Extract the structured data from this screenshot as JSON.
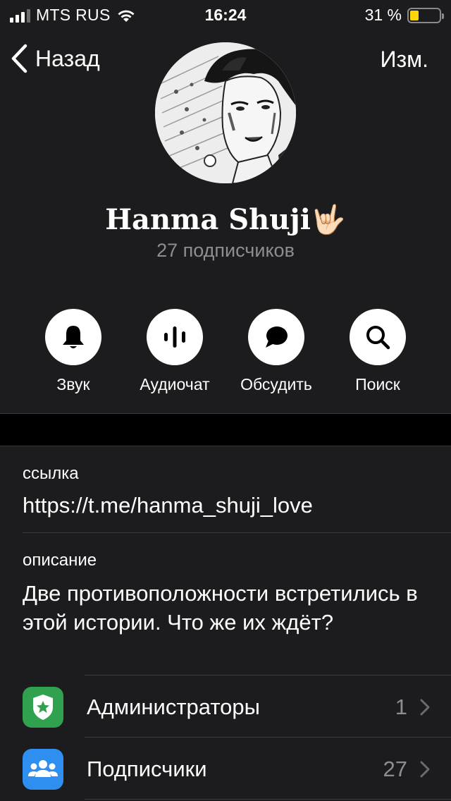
{
  "status_bar": {
    "carrier": "MTS RUS",
    "time": "16:24",
    "battery_percent": "31 %",
    "battery_level": 0.31
  },
  "nav": {
    "back_label": "Назад",
    "edit_label": "Изм."
  },
  "channel": {
    "name": "Hanma Shuji🤟🏻",
    "subscribers": "27 подписчиков"
  },
  "actions": [
    {
      "label": "Звук",
      "icon": "bell-icon"
    },
    {
      "label": "Аудиочат",
      "icon": "voice-chat-icon"
    },
    {
      "label": "Обсудить",
      "icon": "chat-bubble-icon"
    },
    {
      "label": "Поиск",
      "icon": "search-icon"
    }
  ],
  "info": {
    "link_label": "ссылка",
    "link_value": "https://t.me/hanma_shuji_love",
    "description_label": "описание",
    "description_value": "Две противоположности встретились в этой истории. Что же их ждёт?"
  },
  "rows": [
    {
      "label": "Администраторы",
      "count": "1",
      "icon": "admin-badge-icon",
      "color": "#30a14e"
    },
    {
      "label": "Подписчики",
      "count": "27",
      "icon": "people-icon",
      "color": "#2f8ff0"
    }
  ],
  "colors": {
    "background": "#1c1c1e",
    "secondary_text": "#8d8d93",
    "battery_fill": "#ffd60a"
  }
}
